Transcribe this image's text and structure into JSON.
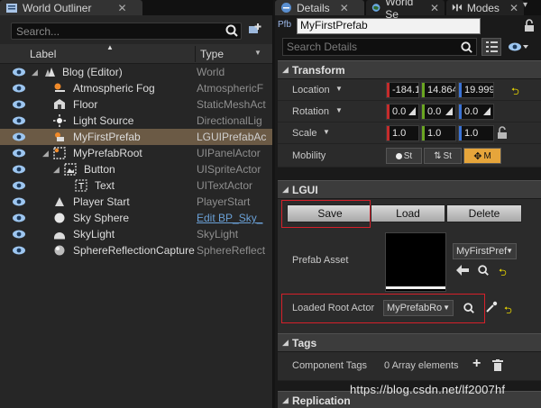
{
  "outliner": {
    "tab_title": "World Outliner",
    "search_placeholder": "Search...",
    "col_label": "Label",
    "col_type": "Type",
    "rows": [
      {
        "label": "Blog (Editor)",
        "type": "World"
      },
      {
        "label": "Atmospheric Fog",
        "type": "AtmosphericF"
      },
      {
        "label": "Floor",
        "type": "StaticMeshAct"
      },
      {
        "label": "Light Source",
        "type": "DirectionalLig"
      },
      {
        "label": "MyFirstPrefab",
        "type": "LGUIPrefabAc"
      },
      {
        "label": "MyPrefabRoot",
        "type": "UIPanelActor"
      },
      {
        "label": "Button",
        "type": "UISpriteActor"
      },
      {
        "label": "Text",
        "type": "UITextActor"
      },
      {
        "label": "Player Start",
        "type": "PlayerStart"
      },
      {
        "label": "Sky Sphere",
        "type": "Edit BP_Sky_"
      },
      {
        "label": "SkyLight",
        "type": "SkyLight"
      },
      {
        "label": "SphereReflectionCapture",
        "type": "SphereReflect"
      }
    ]
  },
  "details": {
    "tabs": [
      "Details",
      "World Se",
      "Modes"
    ],
    "pfb_label": "Pfb",
    "object_name": "MyFirstPrefab",
    "search_placeholder": "Search Details",
    "transform": {
      "title": "Transform",
      "location_label": "Location",
      "location": [
        "-184.1",
        "14.864",
        "19.999"
      ],
      "rotation_label": "Rotation",
      "rotation": [
        "0.0",
        "0.0",
        "0.0"
      ],
      "scale_label": "Scale",
      "scale": [
        "1.0",
        "1.0",
        "1.0"
      ],
      "mobility_label": "Mobility",
      "mobility_static": "St",
      "mobility_stationary": "St",
      "mobility_movable": "M"
    },
    "lgui": {
      "title": "LGUI",
      "save": "Save",
      "load": "Load",
      "delete": "Delete",
      "prefab_asset_label": "Prefab Asset",
      "prefab_asset_value": "MyFirstPref",
      "loaded_root_label": "Loaded Root Actor",
      "loaded_root_value": "MyPrefabRo"
    },
    "tags": {
      "title": "Tags",
      "component_tags_label": "Component Tags",
      "component_tags_value": "0 Array elements"
    },
    "replication": {
      "title": "Replication"
    }
  },
  "watermark": "https://blog.csdn.net/lf2007hf",
  "colors": {
    "accent_red": "#d6202a",
    "x_axis": "#c52b2b",
    "y_axis": "#6aa621",
    "z_axis": "#3a73d6",
    "selected_row": "#6b5a45"
  }
}
